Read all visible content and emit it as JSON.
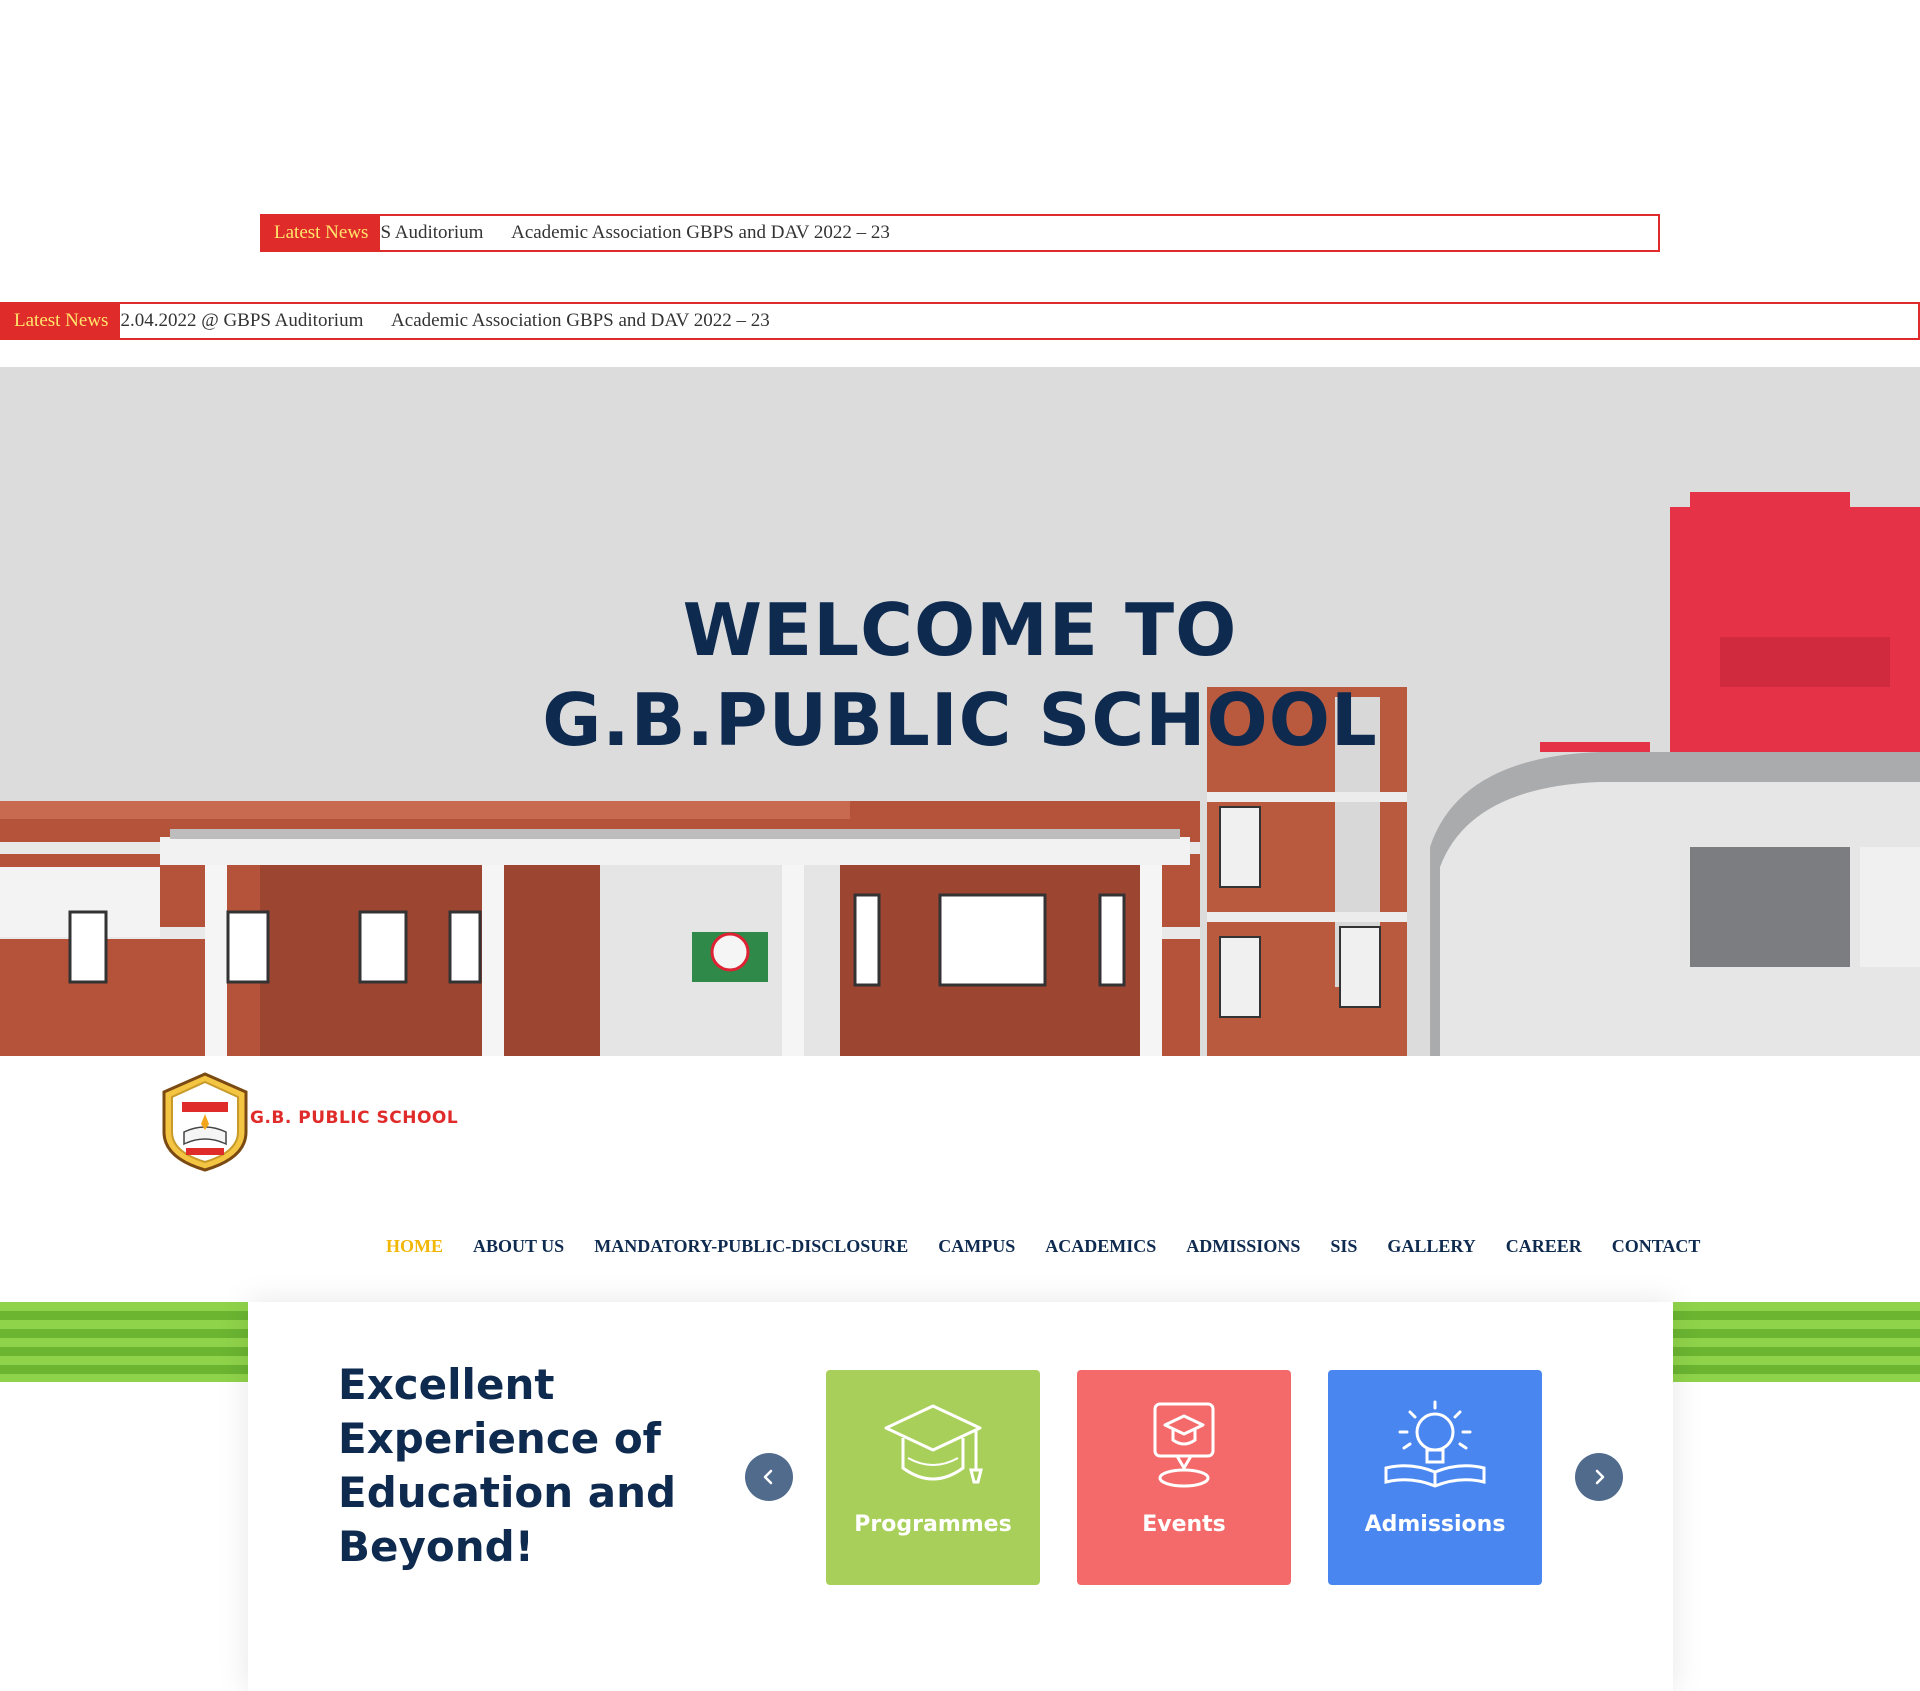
{
  "ticker_top": {
    "label": "Latest News",
    "items": [
      "S Auditorium",
      "Academic Association GBPS and DAV 2022 – 23"
    ]
  },
  "ticker_main": {
    "label": "Latest News",
    "items": [
      "2.04.2022 @ GBPS Auditorium",
      "Academic Association GBPS and DAV 2022 – 23"
    ]
  },
  "hero": {
    "line1": "WELCOME TO",
    "line2": "G.B.PUBLIC SCHOOL"
  },
  "brand": {
    "name": "G.B. PUBLIC SCHOOL"
  },
  "nav": {
    "items": [
      {
        "label": "HOME",
        "active": true
      },
      {
        "label": "ABOUT US"
      },
      {
        "label": "MANDATORY-PUBLIC-DISCLOSURE"
      },
      {
        "label": "CAMPUS"
      },
      {
        "label": "ACADEMICS"
      },
      {
        "label": "ADMISSIONS"
      },
      {
        "label": "SIS"
      },
      {
        "label": "GALLERY"
      },
      {
        "label": "CAREER"
      },
      {
        "label": "CONTACT"
      }
    ]
  },
  "features": {
    "tagline": "Excellent Experience of Education and Beyond!",
    "prev_icon": "chevron-left-icon",
    "next_icon": "chevron-right-icon",
    "tiles": [
      {
        "label": "Programmes",
        "icon": "graduation-cap-icon",
        "color": "#a8cf5a"
      },
      {
        "label": "Events",
        "icon": "event-board-icon",
        "color": "#f46a6a"
      },
      {
        "label": "Admissions",
        "icon": "lightbulb-book-icon",
        "color": "#4a86ef"
      }
    ]
  },
  "colors": {
    "primary": "#0e2a4f",
    "accent_red": "#e02b2b",
    "nav_active": "#f2b705"
  }
}
